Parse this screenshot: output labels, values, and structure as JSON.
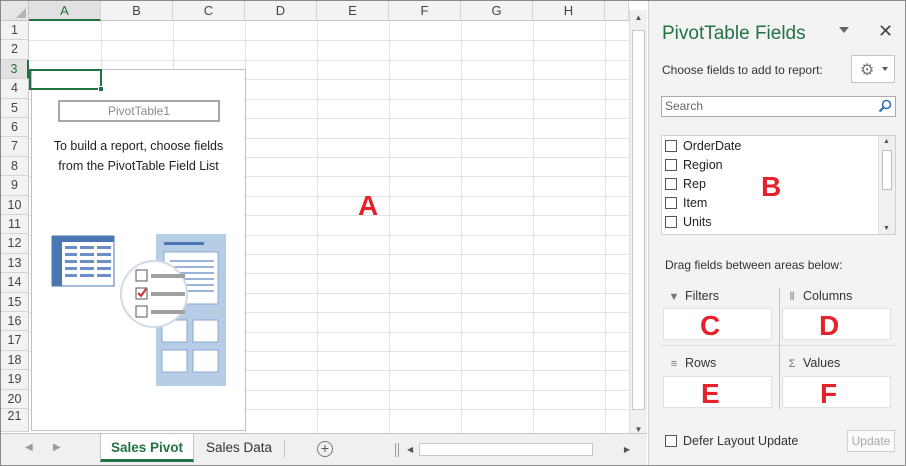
{
  "sheet": {
    "columns": [
      "A",
      "B",
      "C",
      "D",
      "E",
      "F",
      "G",
      "H"
    ],
    "rows": [
      "1",
      "2",
      "3",
      "4",
      "5",
      "6",
      "7",
      "8",
      "9",
      "10",
      "11",
      "12",
      "13",
      "14",
      "15",
      "16",
      "17",
      "18",
      "19",
      "20",
      "21"
    ],
    "selected_column": "A",
    "selected_row": "3"
  },
  "pivot_placeholder": {
    "name": "PivotTable1",
    "instruction_line1": "To build a report, choose fields",
    "instruction_line2": "from the PivotTable Field List"
  },
  "annotations": {
    "a": "A",
    "b": "B",
    "c": "C",
    "d": "D",
    "e": "E",
    "f": "F"
  },
  "tabs": {
    "items": [
      "Sales Pivot",
      "Sales Data"
    ],
    "active": "Sales Pivot",
    "add_icon": "plus-circle-icon"
  },
  "pane": {
    "title": "PivotTable Fields",
    "subtitle": "Choose fields to add to report:",
    "search_placeholder": "Search",
    "fields": [
      "OrderDate",
      "Region",
      "Rep",
      "Item",
      "Units"
    ],
    "drag_label": "Drag fields between areas below:",
    "areas": {
      "filters": "Filters",
      "columns": "Columns",
      "rows": "Rows",
      "values": "Values"
    },
    "defer_label": "Defer Layout Update",
    "update_label": "Update",
    "accent": "#217346"
  },
  "colors": {
    "excel_green": "#217346",
    "annotation_red": "#e8202a"
  }
}
